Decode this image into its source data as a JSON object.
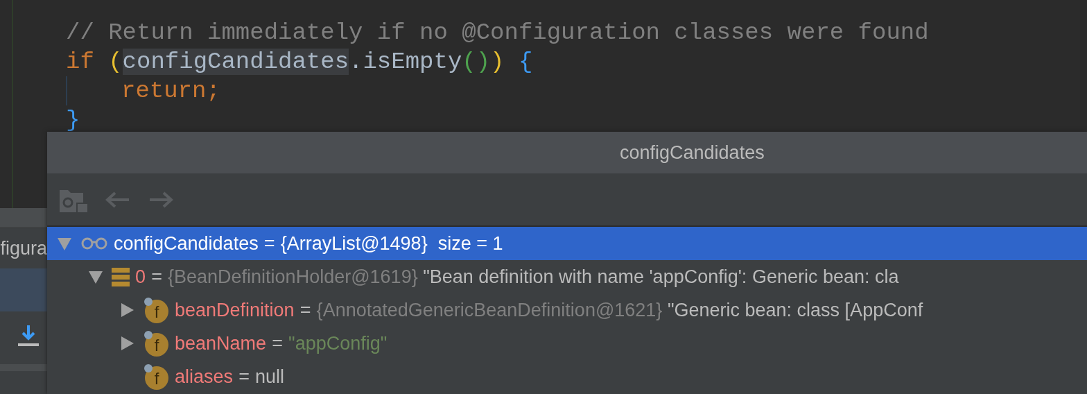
{
  "editor": {
    "lines": [
      {
        "indented": false,
        "tokens": [
          {
            "kind": "comment",
            "text": "// Return immediately if no @Configuration classes were found"
          }
        ]
      },
      {
        "indented": false,
        "tokens": [
          {
            "kind": "keyword",
            "text": "if"
          },
          {
            "kind": "paren",
            "text": "(",
            "space_before": true
          },
          {
            "kind": "highlight",
            "text": "configCandidates"
          },
          {
            "kind": "plain",
            "text": ".isEmpty"
          },
          {
            "kind": "call-paren",
            "text": "()"
          },
          {
            "kind": "paren",
            "text": ")"
          },
          {
            "kind": "brace",
            "text": "{",
            "space_before": true
          }
        ]
      },
      {
        "indented": true,
        "tokens": [
          {
            "kind": "keyword",
            "text": "return;"
          }
        ]
      },
      {
        "indented": false,
        "tokens": [
          {
            "kind": "brace",
            "text": "}"
          }
        ]
      }
    ]
  },
  "side_panel": {
    "tab_label": "figura"
  },
  "popup": {
    "title": "configCandidates",
    "tree": [
      {
        "kind": "watch",
        "name": "configCandidates",
        "separator": "=",
        "type": "{ArrayList@1498}",
        "value": "size = 1",
        "string": false,
        "selected": true,
        "expanded": true,
        "children": [
          {
            "kind": "array",
            "name": "0",
            "separator": "=",
            "type": "{BeanDefinitionHolder@1619}",
            "value": "\"Bean definition with name 'appConfig': Generic bean: cla",
            "string": false,
            "selected": false,
            "expanded": true,
            "children": [
              {
                "kind": "field",
                "badge": "f",
                "name": "beanDefinition",
                "separator": "=",
                "type": "{AnnotatedGenericBeanDefinition@1621}",
                "value": "\"Generic bean: class [AppConf",
                "string": false,
                "selected": false,
                "expanded": false
              },
              {
                "kind": "field",
                "badge": "f",
                "name": "beanName",
                "separator": "=",
                "value": "\"appConfig\"",
                "string": true,
                "selected": false,
                "expanded": false
              },
              {
                "kind": "field",
                "badge": "f",
                "name": "aliases",
                "separator": "=",
                "value": "null",
                "string": false,
                "selected": false
              }
            ]
          }
        ]
      }
    ]
  }
}
